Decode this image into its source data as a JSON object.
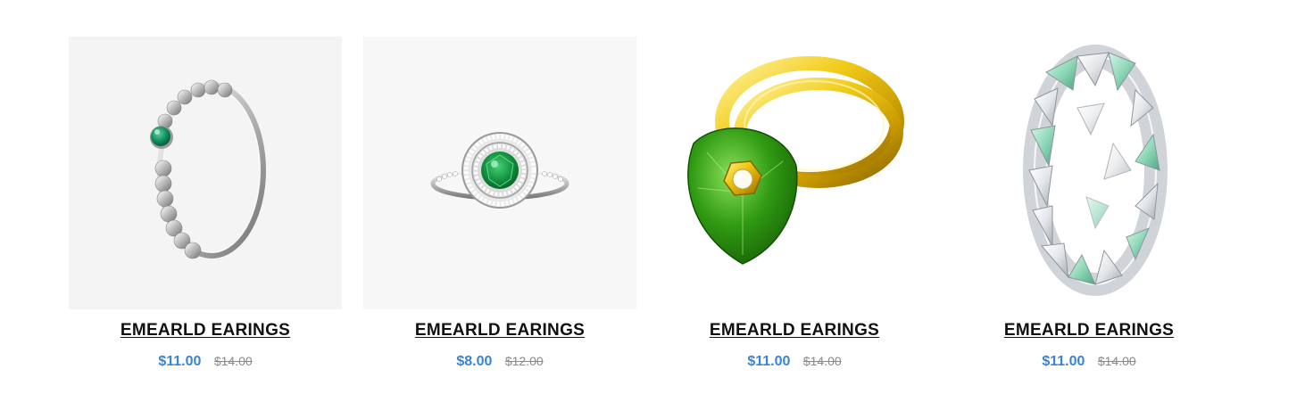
{
  "products": [
    {
      "title": "EMEARLD EARINGS",
      "price": "$11.00",
      "compare_price": "$14.00",
      "image_icon": "beaded-silver-ring-green-stone",
      "image_bg": "#f4f4f4"
    },
    {
      "title": "EMEARLD EARINGS",
      "price": "$8.00",
      "compare_price": "$12.00",
      "image_icon": "halo-emerald-ring",
      "image_bg": "#f7f7f8"
    },
    {
      "title": "EMEARLD EARINGS",
      "price": "$11.00",
      "compare_price": "$14.00",
      "image_icon": "gold-ring-green-pear-stone",
      "image_bg": "#ffffff"
    },
    {
      "title": "EMEARLD EARINGS",
      "price": "$11.00",
      "compare_price": "$14.00",
      "image_icon": "triangle-crystal-eternity-ring",
      "image_bg": "#ffffff"
    }
  ],
  "colors": {
    "price": "#3a84d4",
    "compare_price": "#8a8a8a",
    "title": "#111111"
  }
}
